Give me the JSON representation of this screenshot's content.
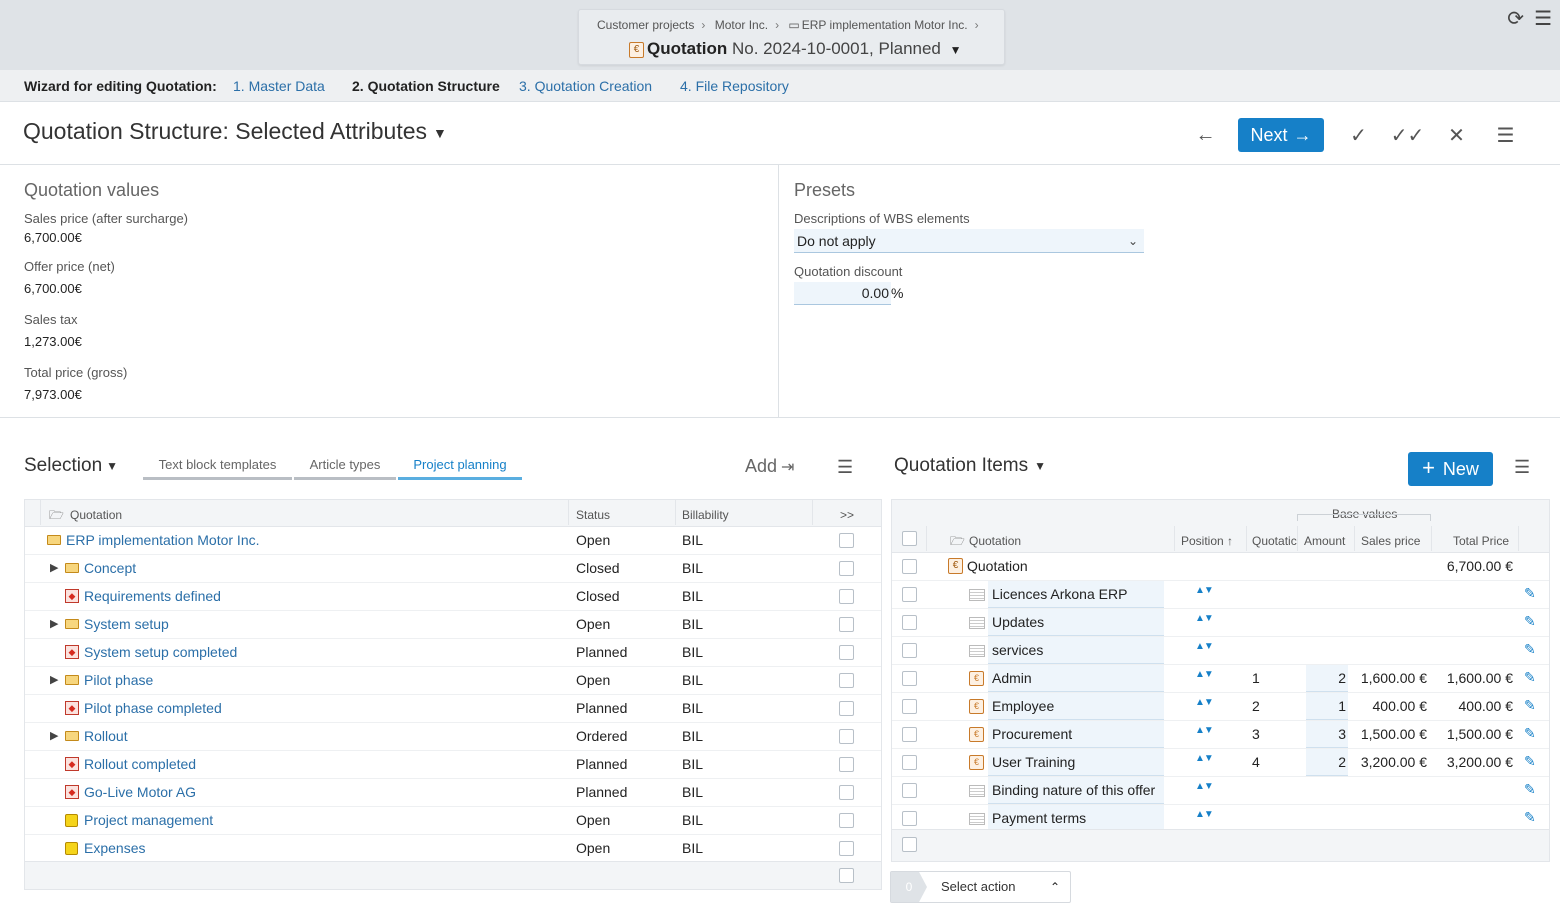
{
  "header": {
    "breadcrumbs": [
      "Customer projects",
      "Motor Inc.",
      "ERP implementation Motor Inc."
    ],
    "object_type": "Quotation",
    "object_rest": "No. 2024-10-0001, Planned",
    "reload_icon": "reload-icon",
    "menu_icon": "hamburger-icon"
  },
  "wizard": {
    "label": "Wizard for editing Quotation:",
    "steps": [
      "1. Master Data",
      "2. Quotation Structure",
      "3. Quotation Creation",
      "4. File Repository"
    ],
    "active_step": 1
  },
  "page": {
    "title": "Quotation Structure: Selected Attributes",
    "next_label": "Next"
  },
  "quotation_values": {
    "title": "Quotation values",
    "fields": [
      {
        "label": "Sales price (after surcharge)",
        "value": "6,700.00€"
      },
      {
        "label": "Offer price (net)",
        "value": "6,700.00€"
      },
      {
        "label": "Sales tax",
        "value": "1,273.00€"
      },
      {
        "label": "Total price (gross)",
        "value": "7,973.00€"
      }
    ]
  },
  "presets": {
    "title": "Presets",
    "wbs_label": "Descriptions of WBS elements",
    "wbs_value": "Do not apply",
    "discount_label": "Quotation discount",
    "discount_value": "0.00",
    "discount_unit": "%"
  },
  "selection": {
    "title": "Selection",
    "tabs": [
      "Text block templates",
      "Article types",
      "Project planning"
    ],
    "active_tab": 2,
    "add_label": "Add",
    "columns": {
      "name": "Quotation",
      "status": "Status",
      "billability": "Billability",
      "more": ">>"
    },
    "rows": [
      {
        "name": "ERP implementation Motor Inc.",
        "status": "Open",
        "bil": "BIL",
        "kind": "folder",
        "expand": false,
        "indent": 0
      },
      {
        "name": "Concept",
        "status": "Closed",
        "bil": "BIL",
        "kind": "folder",
        "expand": true,
        "indent": 1
      },
      {
        "name": "Requirements defined",
        "status": "Closed",
        "bil": "BIL",
        "kind": "milestone",
        "expand": false,
        "indent": 1
      },
      {
        "name": "System setup",
        "status": "Open",
        "bil": "BIL",
        "kind": "folder",
        "expand": true,
        "indent": 1
      },
      {
        "name": "System setup completed",
        "status": "Planned",
        "bil": "BIL",
        "kind": "milestone",
        "expand": false,
        "indent": 1
      },
      {
        "name": "Pilot phase",
        "status": "Open",
        "bil": "BIL",
        "kind": "folder",
        "expand": true,
        "indent": 1
      },
      {
        "name": "Pilot phase completed",
        "status": "Planned",
        "bil": "BIL",
        "kind": "milestone",
        "expand": false,
        "indent": 1
      },
      {
        "name": "Rollout",
        "status": "Ordered",
        "bil": "BIL",
        "kind": "folder",
        "expand": true,
        "indent": 1
      },
      {
        "name": "Rollout completed",
        "status": "Planned",
        "bil": "BIL",
        "kind": "milestone",
        "expand": false,
        "indent": 1
      },
      {
        "name": "Go-Live Motor AG",
        "status": "Planned",
        "bil": "BIL",
        "kind": "milestone",
        "expand": false,
        "indent": 1
      },
      {
        "name": "Project management",
        "status": "Open",
        "bil": "BIL",
        "kind": "pm",
        "expand": false,
        "indent": 1
      },
      {
        "name": "Expenses",
        "status": "Open",
        "bil": "BIL",
        "kind": "pm",
        "expand": false,
        "indent": 1
      }
    ]
  },
  "quotation_items": {
    "title": "Quotation Items",
    "new_label": "New",
    "group_header": "Base values",
    "columns": {
      "name": "Quotation",
      "position": "Position",
      "quotation_no": "Quotatic",
      "amount": "Amount",
      "sales_price": "Sales price",
      "total": "Total Price"
    },
    "root": {
      "name": "Quotation",
      "total": "6,700.00 €"
    },
    "rows": [
      {
        "desc": "Licences Arkona ERP",
        "kind": "text",
        "pos": "",
        "amount": "",
        "price": "",
        "total": ""
      },
      {
        "desc": "Updates",
        "kind": "text",
        "pos": "",
        "amount": "",
        "price": "",
        "total": ""
      },
      {
        "desc": "services",
        "kind": "text",
        "pos": "",
        "amount": "",
        "price": "",
        "total": ""
      },
      {
        "desc": "Admin",
        "kind": "article",
        "pos": "1",
        "amount": "2",
        "price": "1,600.00 €",
        "total": "1,600.00 €"
      },
      {
        "desc": "Employee",
        "kind": "article",
        "pos": "2",
        "amount": "1",
        "price": "400.00 €",
        "total": "400.00 €"
      },
      {
        "desc": "Procurement",
        "kind": "article",
        "pos": "3",
        "amount": "3",
        "price": "1,500.00 €",
        "total": "1,500.00 €"
      },
      {
        "desc": "User Training",
        "kind": "article",
        "pos": "4",
        "amount": "2",
        "price": "3,200.00 €",
        "total": "3,200.00 €"
      },
      {
        "desc": "Binding nature of this offer",
        "kind": "text",
        "pos": "",
        "amount": "",
        "price": "",
        "total": ""
      },
      {
        "desc": "Payment terms",
        "kind": "text",
        "pos": "",
        "amount": "",
        "price": "",
        "total": ""
      }
    ],
    "selected_count": "0",
    "action_label": "Select action"
  },
  "colors": {
    "accent": "#1680c8",
    "link": "#2b6fa8"
  }
}
